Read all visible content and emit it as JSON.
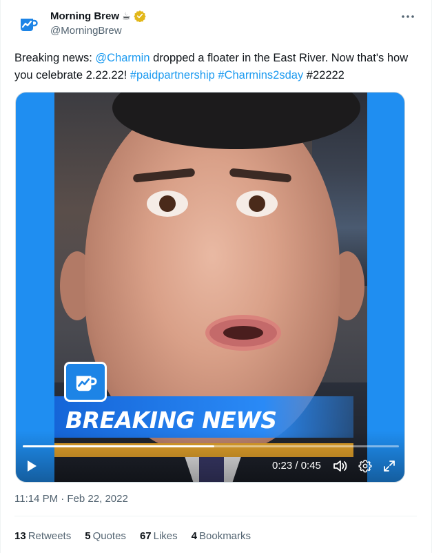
{
  "author": {
    "display_name": "Morning Brew",
    "emoji": "☕",
    "handle": "@MorningBrew",
    "verified_badge_color": "#e2b719",
    "avatar_color": "#1d84e6"
  },
  "tweet": {
    "text_prefix": "Breaking news: ",
    "mention": "@Charmin",
    "text_middle": " dropped a floater in the East River. Now that's how you celebrate 2.22.22! ",
    "hashtag_1": "#paidpartnership",
    "hashtag_2": "#Charmins2sday",
    "text_suffix": " #22222"
  },
  "video": {
    "banner_text": "BREAKING NEWS",
    "time_display": "0:23 / 0:45",
    "progress": 0.51,
    "background_color": "#1f8ef1"
  },
  "footer": {
    "timestamp": "11:14 PM · Feb 22, 2022",
    "stats": [
      {
        "count": "13",
        "label": "Retweets"
      },
      {
        "count": "5",
        "label": "Quotes"
      },
      {
        "count": "67",
        "label": "Likes"
      },
      {
        "count": "4",
        "label": "Bookmarks"
      }
    ]
  },
  "colors": {
    "link": "#1d9bf0",
    "secondary_text": "#536471",
    "primary_text": "#0f1419"
  }
}
